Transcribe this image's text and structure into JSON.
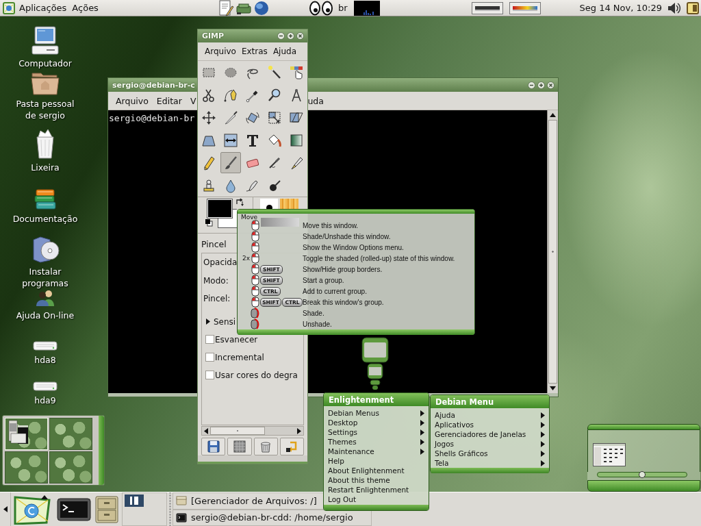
{
  "top_panel": {
    "menus": [
      {
        "label": "Aplicações"
      },
      {
        "label": "Ações"
      }
    ],
    "keyboard_layout": "br",
    "clock": "Seg 14 Nov, 10:29"
  },
  "desktop_icons": [
    {
      "kind": "computer",
      "label": "Computador"
    },
    {
      "kind": "home-folder",
      "label": "Pasta pessoal de sergio"
    },
    {
      "kind": "trash",
      "label": "Lixeira"
    },
    {
      "kind": "books",
      "label": "Documentação"
    },
    {
      "kind": "installer",
      "label": "Instalar programas"
    },
    {
      "kind": "people",
      "label": "Ajuda On-line"
    },
    {
      "kind": "drive",
      "label": "hda8"
    },
    {
      "kind": "drive",
      "label": "hda9"
    }
  ],
  "terminal_window": {
    "title": "sergio@debian-br-c",
    "menus": [
      {
        "label": "Arquivo"
      },
      {
        "label": "Editar"
      },
      {
        "label": "V"
      },
      {
        "label": "uda"
      }
    ],
    "prompt": "sergio@debian-br"
  },
  "gimp_window": {
    "title": "GIMP",
    "menus": [
      {
        "label": "Arquivo"
      },
      {
        "label": "Extras"
      },
      {
        "label": "Ajuda"
      }
    ],
    "tools": [
      {
        "kind": "rect-select",
        "selected": false
      },
      {
        "kind": "ellipse-select",
        "selected": false
      },
      {
        "kind": "free-select",
        "selected": false
      },
      {
        "kind": "fuzzy-select",
        "selected": false
      },
      {
        "kind": "by-color-select",
        "selected": false
      },
      {
        "kind": "scissors",
        "selected": false
      },
      {
        "kind": "paths",
        "selected": false
      },
      {
        "kind": "color-picker",
        "selected": false
      },
      {
        "kind": "zoom",
        "selected": false
      },
      {
        "kind": "measure",
        "selected": false
      },
      {
        "kind": "move",
        "selected": false
      },
      {
        "kind": "crop",
        "selected": false
      },
      {
        "kind": "rotate",
        "selected": false
      },
      {
        "kind": "scale",
        "selected": false
      },
      {
        "kind": "shear",
        "selected": false
      },
      {
        "kind": "perspective",
        "selected": false
      },
      {
        "kind": "flip",
        "selected": false
      },
      {
        "kind": "text",
        "selected": false
      },
      {
        "kind": "bucket-fill",
        "selected": false
      },
      {
        "kind": "blend",
        "selected": false
      },
      {
        "kind": "pencil",
        "selected": false
      },
      {
        "kind": "paintbrush",
        "selected": true
      },
      {
        "kind": "eraser",
        "selected": false
      },
      {
        "kind": "airbrush",
        "selected": false
      },
      {
        "kind": "ink",
        "selected": false
      },
      {
        "kind": "clone",
        "selected": false
      },
      {
        "kind": "blur",
        "selected": false
      },
      {
        "kind": "smudge",
        "selected": false
      },
      {
        "kind": "dodge",
        "selected": false
      }
    ],
    "tool_options": {
      "title": "Pincel",
      "fields": [
        {
          "label": "Opacida"
        },
        {
          "label": "Modo:"
        },
        {
          "label": "Pincel:"
        }
      ],
      "expander": {
        "label": "Sensi",
        "expanded": false
      },
      "checkboxes": [
        {
          "label": "Esvanecer",
          "checked": false
        },
        {
          "label": "Incremental",
          "checked": false
        },
        {
          "label": "Usar cores do degra",
          "checked": false
        }
      ]
    }
  },
  "mouse_bindings_tooltip": {
    "title": "Move",
    "rows": [
      {
        "kind": "button",
        "action": "Move this window."
      },
      {
        "kind": "button",
        "action": "Shade/Unshade this window."
      },
      {
        "kind": "button",
        "action": "Show the Window Options menu."
      },
      {
        "kind": "button",
        "prefix": "2x",
        "action": "Toggle the shaded (rolled-up) state of this window."
      },
      {
        "kind": "button",
        "keys": [
          "SHIFT"
        ],
        "action": "Show/Hide group borders."
      },
      {
        "kind": "button",
        "keys": [
          "SHIFT"
        ],
        "action": "Start a group."
      },
      {
        "kind": "button",
        "keys": [
          "CTRL"
        ],
        "action": "Add to current group."
      },
      {
        "kind": "button",
        "keys": [
          "SHIFT",
          "CTRL"
        ],
        "action": "Break this window's group."
      },
      {
        "kind": "wheel",
        "action": "Shade."
      },
      {
        "kind": "wheel",
        "action": "Unshade."
      }
    ]
  },
  "enlightenment_menu": {
    "title": "Enlightenment",
    "items": [
      {
        "label": "Debian Menus",
        "submenu": true
      },
      {
        "label": "Desktop",
        "submenu": true
      },
      {
        "label": "Settings",
        "submenu": true
      },
      {
        "label": "Themes",
        "submenu": true
      },
      {
        "label": "Maintenance",
        "submenu": true
      },
      {
        "label": "Help",
        "submenu": false
      },
      {
        "label": "About Enlightenment",
        "submenu": false
      },
      {
        "label": "About this theme",
        "submenu": false
      },
      {
        "label": "Restart Enlightenment",
        "submenu": false
      },
      {
        "label": "Log Out",
        "submenu": false
      }
    ]
  },
  "debian_menu": {
    "title": "Debian Menu",
    "items": [
      {
        "label": "Ajuda",
        "submenu": true
      },
      {
        "label": "Aplicativos",
        "submenu": true
      },
      {
        "label": "Gerenciadores de Janelas",
        "submenu": true
      },
      {
        "label": "Jogos",
        "submenu": true
      },
      {
        "label": "Shells Gráficos",
        "submenu": true
      },
      {
        "label": "Tela",
        "submenu": true
      }
    ]
  },
  "pager": {
    "desks": [
      {
        "selected": true
      },
      {
        "selected": false
      },
      {
        "selected": false
      },
      {
        "selected": false
      }
    ]
  },
  "taskbar": {
    "tasks": [
      {
        "kind": "folder",
        "label": "[Gerenciador de Arquivos: /]"
      },
      {
        "kind": "terminal",
        "label": "sergio@debian-br-cdd: /home/sergio"
      }
    ]
  }
}
